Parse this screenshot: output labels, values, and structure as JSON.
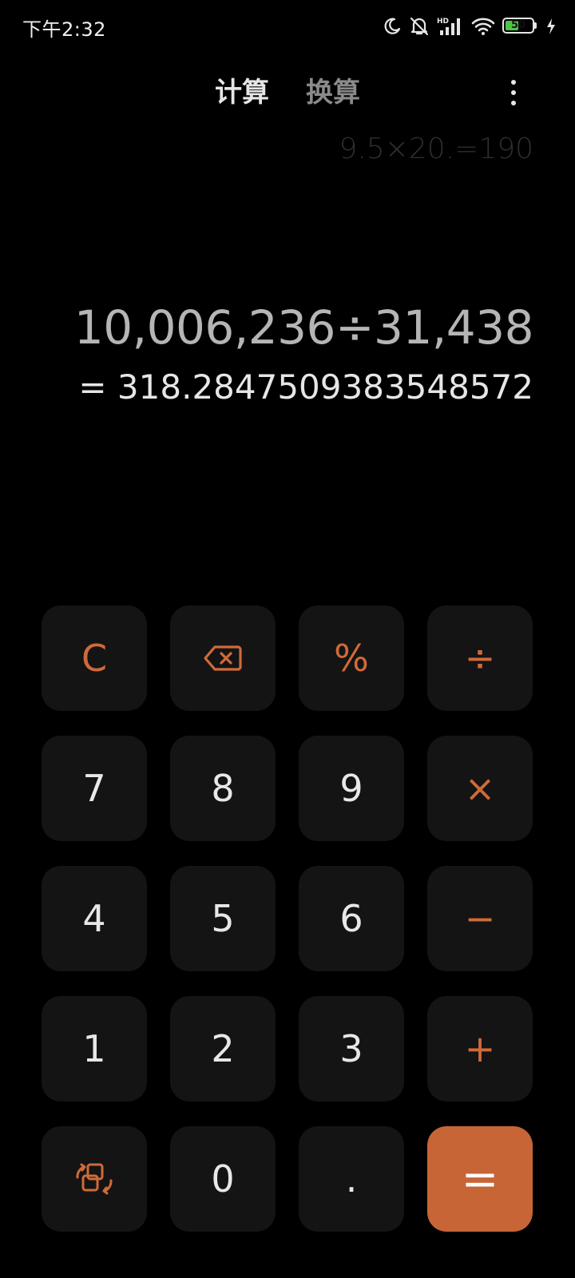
{
  "status_bar": {
    "time": "下午2:32",
    "battery_level": "50",
    "battery_fraction": 0.5,
    "icons": [
      "moon-icon",
      "bell-off-icon",
      "hd-signal-icon",
      "wifi-icon",
      "battery-icon",
      "charging-bolt-icon"
    ]
  },
  "tabs": [
    {
      "label": "计算",
      "active": true
    },
    {
      "label": "换算",
      "active": false
    }
  ],
  "menu_icon": "more-vertical-icon",
  "display": {
    "history": "9.5×20.=190",
    "expression": "10,006,236÷31,438",
    "result": "= 318.2847509383548572"
  },
  "keys": {
    "clear": "C",
    "backspace_icon": "backspace-icon",
    "percent": "%",
    "divide": "÷",
    "seven": "7",
    "eight": "8",
    "nine": "9",
    "multiply": "×",
    "four": "4",
    "five": "5",
    "six": "6",
    "minus": "−",
    "one": "1",
    "two": "2",
    "three": "3",
    "plus": "+",
    "switch_icon": "switch-mode-icon",
    "zero": "0",
    "decimal": ".",
    "equals": "="
  },
  "colors": {
    "background": "#000000",
    "key_background": "#141414",
    "accent": "#c76536",
    "operator_text": "#d06a3a",
    "battery_fill": "#4fc34a"
  }
}
